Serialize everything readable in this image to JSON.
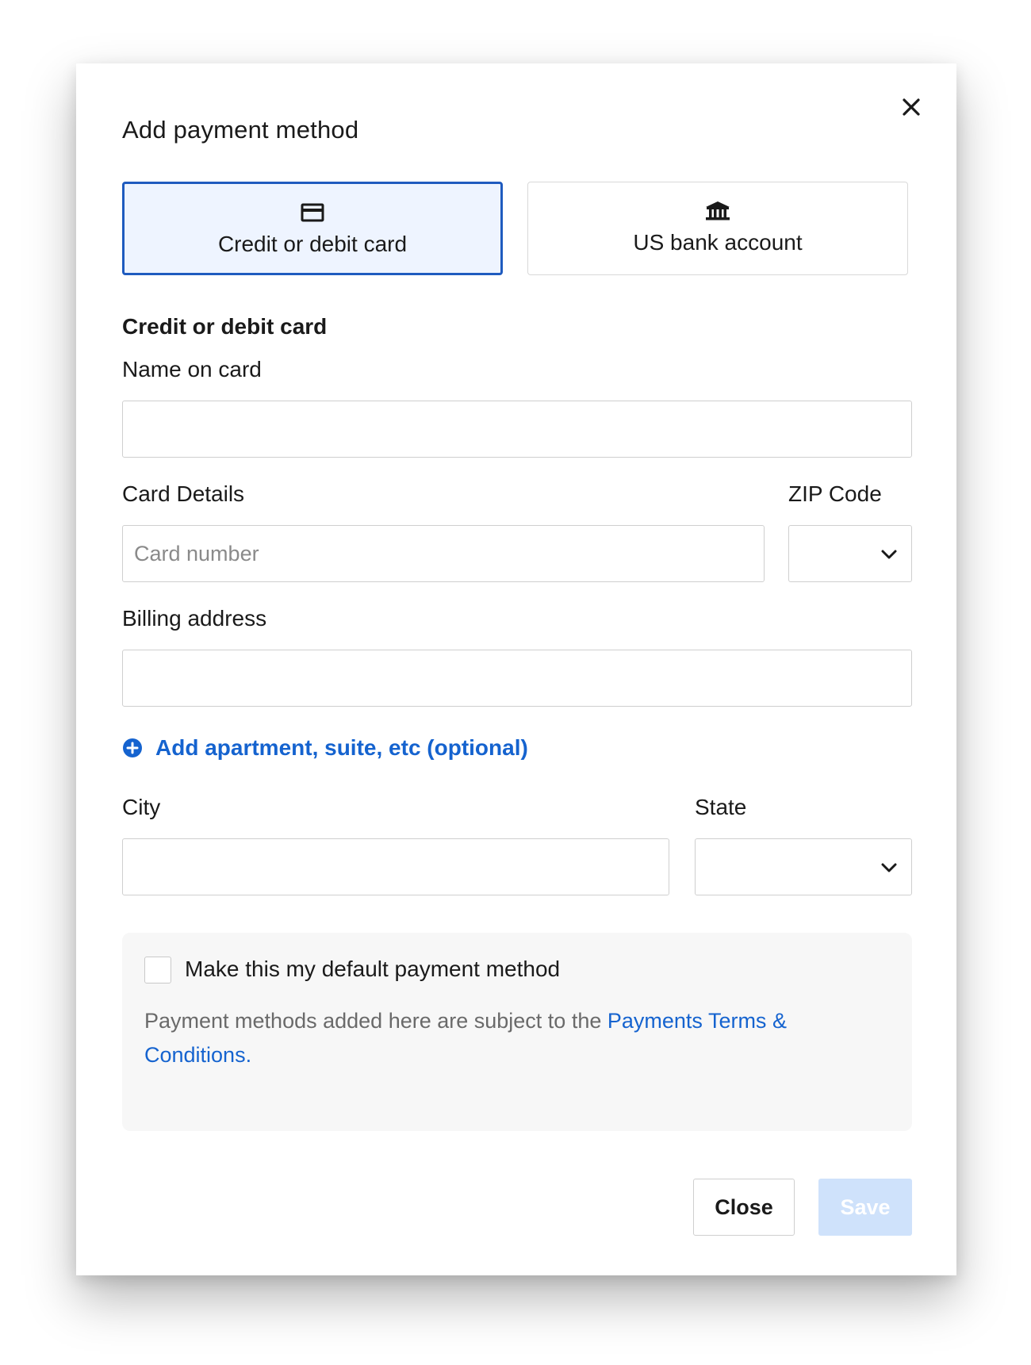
{
  "dialog": {
    "title": "Add payment method",
    "close_icon": "close-x-icon"
  },
  "tabs": [
    {
      "label": "Credit or debit card",
      "icon": "credit-card-icon",
      "selected": true
    },
    {
      "label": "US bank account",
      "icon": "bank-icon",
      "selected": false
    }
  ],
  "form": {
    "section_heading": "Credit or debit card",
    "name_label": "Name on card",
    "name_value": "",
    "card_details_label": "Card Details",
    "card_number_placeholder": "Card number",
    "zip_label": "ZIP Code",
    "zip_value": "",
    "billing_label": "Billing address",
    "billing_value": "",
    "add_apartment_label": "Add apartment, suite, etc (optional)",
    "city_label": "City",
    "city_value": "",
    "state_label": "State",
    "state_value": ""
  },
  "info": {
    "default_checkbox_label": "Make this my default payment method",
    "default_checked": false,
    "terms_text": "Payment methods added here are subject to the ",
    "terms_link": "Payments Terms & Conditions."
  },
  "actions": {
    "close_label": "Close",
    "save_label": "Save"
  },
  "colors": {
    "accent": "#1563cf",
    "selected_tab_border": "#1f5bbf",
    "selected_tab_bg": "#eef4ff",
    "save_disabled_bg": "#cfe2fb"
  }
}
